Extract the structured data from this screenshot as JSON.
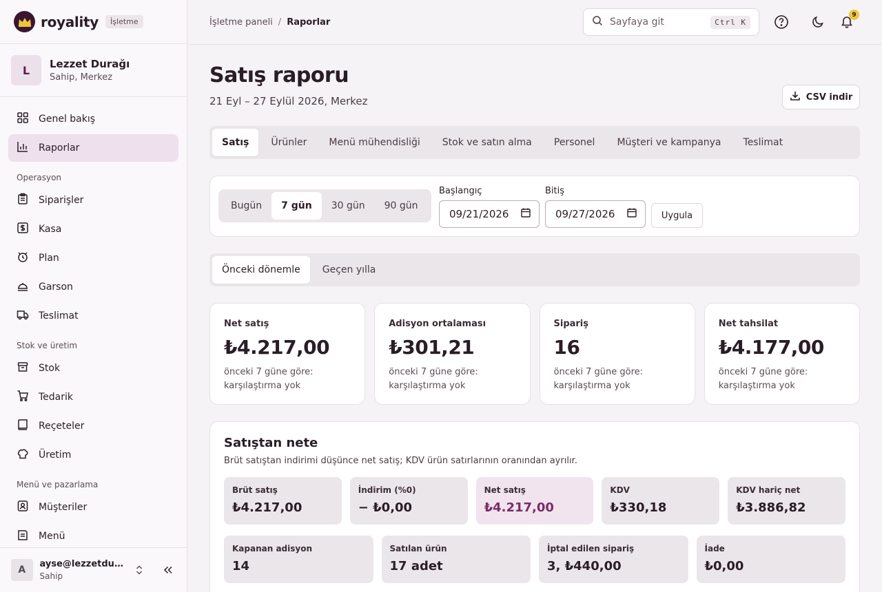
{
  "brand": {
    "name": "royality",
    "badge": "İşletme"
  },
  "org": {
    "initial": "L",
    "name": "Lezzet Durağı",
    "role": "Sahip, Merkez"
  },
  "nav": {
    "top": [
      {
        "label": "Genel bakış",
        "icon": "dashboard-icon"
      },
      {
        "label": "Raporlar",
        "icon": "chart-icon",
        "active": true
      }
    ],
    "sections": [
      {
        "title": "Operasyon",
        "items": [
          {
            "label": "Siparişler",
            "icon": "clipboard-icon"
          },
          {
            "label": "Kasa",
            "icon": "cash-icon"
          },
          {
            "label": "Plan",
            "icon": "floor-plan-icon"
          },
          {
            "label": "Garson",
            "icon": "waiter-icon"
          },
          {
            "label": "Teslimat",
            "icon": "truck-icon"
          }
        ]
      },
      {
        "title": "Stok ve üretim",
        "items": [
          {
            "label": "Stok",
            "icon": "box-icon"
          },
          {
            "label": "Tedarik",
            "icon": "cart-icon"
          },
          {
            "label": "Reçeteler",
            "icon": "book-icon"
          },
          {
            "label": "Üretim",
            "icon": "chef-hat-icon"
          }
        ]
      },
      {
        "title": "Menü ve pazarlama",
        "items": [
          {
            "label": "Müşteriler",
            "icon": "contact-icon"
          },
          {
            "label": "Menü",
            "icon": "menu-icon"
          }
        ]
      }
    ]
  },
  "user": {
    "initial": "A",
    "email": "ayse@lezzetduragi.com",
    "role": "Sahip"
  },
  "topbar": {
    "breadcrumb_root": "İşletme paneli",
    "breadcrumb_sep": "/",
    "breadcrumb_current": "Raporlar",
    "search_placeholder": "Sayfaya git",
    "shortcut": "Ctrl K",
    "notification_count": "9"
  },
  "page": {
    "title": "Satış raporu",
    "subtitle": "21 Eyl – 27 Eylül 2026, Merkez",
    "csv_label": "CSV indir"
  },
  "tabs": [
    "Satış",
    "Ürünler",
    "Menü mühendisliği",
    "Stok ve satın alma",
    "Personel",
    "Müşteri ve kampanya",
    "Teslimat"
  ],
  "filters": {
    "ranges": [
      "Bugün",
      "7 gün",
      "30 gün",
      "90 gün"
    ],
    "start_label": "Başlangıç",
    "start_value": "09/21/2026",
    "end_label": "Bitiş",
    "end_value": "09/27/2026",
    "apply_label": "Uygula"
  },
  "compare": [
    "Önceki dönemle",
    "Geçen yılla"
  ],
  "kpis": [
    {
      "label": "Net satış",
      "value": "₺4.217,00",
      "note": "önceki 7 güne göre: karşılaştırma yok"
    },
    {
      "label": "Adisyon ortalaması",
      "value": "₺301,21",
      "note": "önceki 7 güne göre: karşılaştırma yok"
    },
    {
      "label": "Sipariş",
      "value": "16",
      "note": "önceki 7 güne göre: karşılaştırma yok"
    },
    {
      "label": "Net tahsilat",
      "value": "₺4.177,00",
      "note": "önceki 7 güne göre: karşılaştırma yok"
    }
  ],
  "net": {
    "title": "Satıştan nete",
    "description": "Brüt satıştan indirimi düşünce net satış; KDV ürün satırlarının oranından ayrılır.",
    "row1": [
      {
        "label": "Brüt satış",
        "value": "₺4.217,00"
      },
      {
        "label": "İndirim (%0)",
        "value": "− ₺0,00"
      },
      {
        "label": "Net satış",
        "value": "₺4.217,00",
        "highlight": true
      },
      {
        "label": "KDV",
        "value": "₺330,18"
      },
      {
        "label": "KDV hariç net",
        "value": "₺3.886,82"
      }
    ],
    "row2": [
      {
        "label": "Kapanan adisyon",
        "value": "14"
      },
      {
        "label": "Satılan ürün",
        "value": "17 adet"
      },
      {
        "label": "İptal edilen sipariş",
        "value": "3, ₺440,00"
      },
      {
        "label": "İade",
        "value": "₺0,00"
      }
    ]
  },
  "colors": {
    "accent": "#7a2d68",
    "active_bg": "#eee0ec",
    "brand_dark": "#3a1730",
    "badge": "#f0c63b"
  }
}
